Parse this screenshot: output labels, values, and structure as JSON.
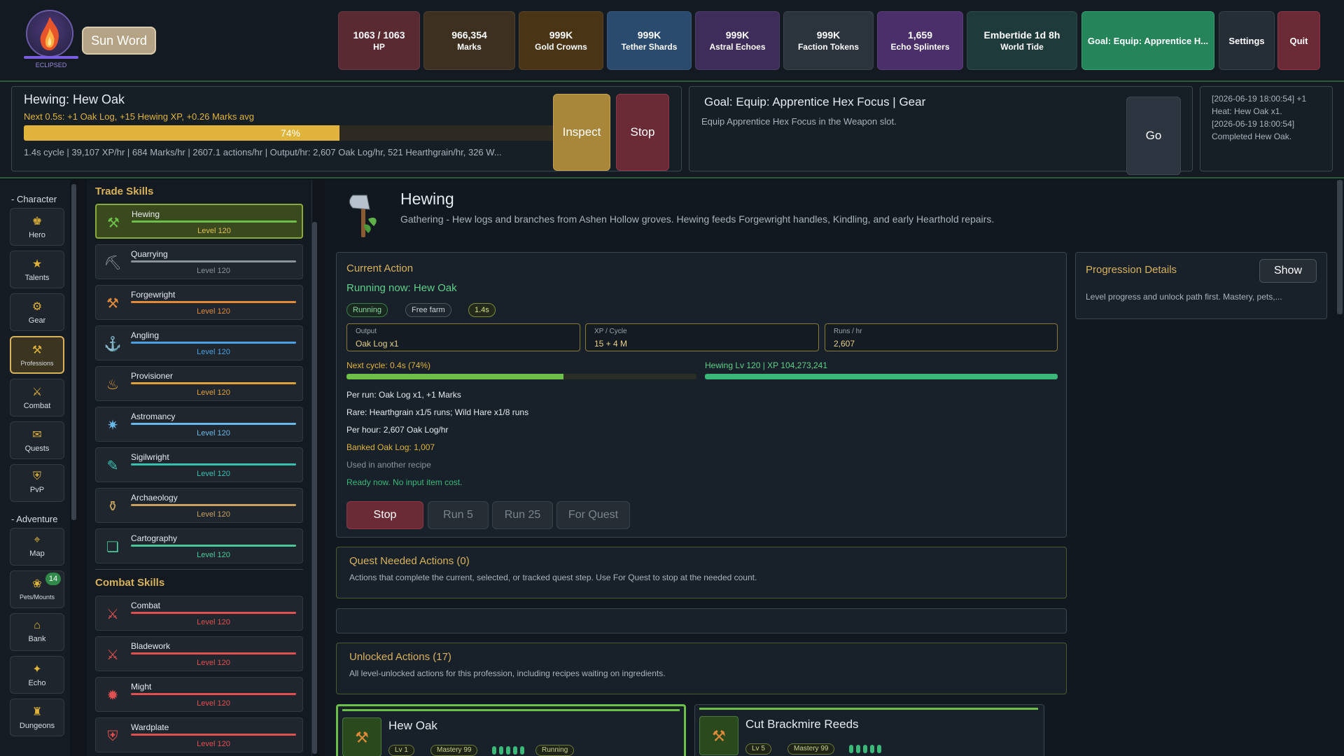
{
  "top": {
    "avatar_label": "ECLIPSED",
    "sun_word": "Sun Word",
    "stats": [
      {
        "value": "1063 / 1063",
        "label": "HP",
        "color": "#5a2a33"
      },
      {
        "value": "966,354",
        "label": "Marks",
        "color": "#3d3020"
      },
      {
        "value": "999K",
        "label": "Gold Crowns",
        "color": "#4a3416"
      },
      {
        "value": "999K",
        "label": "Tether Shards",
        "color": "#2a4a6e"
      },
      {
        "value": "999K",
        "label": "Astral Echoes",
        "color": "#3e2d5a"
      },
      {
        "value": "999K",
        "label": "Faction Tokens",
        "color": "#2b333d"
      },
      {
        "value": "1,659",
        "label": "Echo Splinters",
        "color": "#4a2f6a"
      },
      {
        "value": "Embertide 1d 8h",
        "label": "World Tide",
        "color": "#1f3a3a"
      }
    ],
    "goal_button": "Goal: Equip: Apprentice H...",
    "settings": "Settings",
    "quit": "Quit"
  },
  "action": {
    "title": "Hewing: Hew Oak",
    "next": "Next 0.5s: +1 Oak Log, +15 Hewing XP, +0.26 Marks avg",
    "progress": 74,
    "progress_label": "74%",
    "stats_line": "1.4s cycle | 39,107 XP/hr | 684 Marks/hr | 2607.1 actions/hr | Output/hr: 2,607 Oak Log/hr, 521 Hearthgrain/hr, 326 W...",
    "inspect": "Inspect",
    "stop": "Stop"
  },
  "goal": {
    "title": "Goal: Equip: Apprentice Hex Focus | Gear",
    "desc": "Equip Apprentice Hex Focus in the Weapon slot.",
    "go": "Go"
  },
  "log": [
    "[2026-06-19 18:00:54] +1",
    "Heat: Hew Oak x1.",
    "[2026-06-19 18:00:54]",
    "Completed Hew Oak."
  ],
  "nav": {
    "character_label": "- Character",
    "adventure_label": "- Adventure",
    "character": [
      {
        "icon": "hero-icon",
        "glyph": "♚",
        "label": "Hero"
      },
      {
        "icon": "star-icon",
        "glyph": "★",
        "label": "Talents"
      },
      {
        "icon": "gear-icon",
        "glyph": "⚙",
        "label": "Gear"
      },
      {
        "icon": "anvil-icon",
        "glyph": "⚒",
        "label": "Professions",
        "active": true
      },
      {
        "icon": "swords-icon",
        "glyph": "⚔",
        "label": "Combat"
      },
      {
        "icon": "scroll-icon",
        "glyph": "✉",
        "label": "Quests"
      },
      {
        "icon": "shield-icon",
        "glyph": "⛨",
        "label": "PvP"
      }
    ],
    "adventure": [
      {
        "icon": "map-icon",
        "glyph": "⌖",
        "label": "Map"
      },
      {
        "icon": "paw-icon",
        "glyph": "❀",
        "label": "Pets/Mounts",
        "badge": "14"
      },
      {
        "icon": "bank-icon",
        "glyph": "⌂",
        "label": "Bank"
      },
      {
        "icon": "echo-icon",
        "glyph": "✦",
        "label": "Echo"
      },
      {
        "icon": "dungeon-icon",
        "glyph": "♜",
        "label": "Dungeons"
      }
    ]
  },
  "skills": {
    "trade_title": "Trade Skills",
    "combat_title": "Combat Skills",
    "trade": [
      {
        "name": "Hewing",
        "level": "Level 120",
        "color": "#6cc04a",
        "glyph": "⚒",
        "active": true
      },
      {
        "name": "Quarrying",
        "level": "Level 120",
        "color": "#8a929c",
        "glyph": "⛏"
      },
      {
        "name": "Forgewright",
        "level": "Level 120",
        "color": "#e08a3a",
        "glyph": "⚒"
      },
      {
        "name": "Angling",
        "level": "Level 120",
        "color": "#4aa0e0",
        "glyph": "⚓"
      },
      {
        "name": "Provisioner",
        "level": "Level 120",
        "color": "#e0a03a",
        "glyph": "♨"
      },
      {
        "name": "Astromancy",
        "level": "Level 120",
        "color": "#6ab8e8",
        "glyph": "✷"
      },
      {
        "name": "Sigilwright",
        "level": "Level 120",
        "color": "#3ac0b0",
        "glyph": "✎"
      },
      {
        "name": "Archaeology",
        "level": "Level 120",
        "color": "#c8a060",
        "glyph": "⚱"
      },
      {
        "name": "Cartography",
        "level": "Level 120",
        "color": "#4ac89a",
        "glyph": "❏"
      }
    ],
    "combat": [
      {
        "name": "Combat",
        "level": "Level 120",
        "color": "#e05050",
        "glyph": "⚔"
      },
      {
        "name": "Bladework",
        "level": "Level 120",
        "color": "#e05050",
        "glyph": "⚔"
      },
      {
        "name": "Might",
        "level": "Level 120",
        "color": "#e05050",
        "glyph": "✹"
      },
      {
        "name": "Wardplate",
        "level": "Level 120",
        "color": "#e05050",
        "glyph": "⛨"
      }
    ]
  },
  "profession": {
    "name": "Hewing",
    "desc": "Gathering - Hew logs and branches from Ashen Hollow groves. Hewing feeds Forgewright handles, Kindling, and early Hearthold repairs."
  },
  "current": {
    "heading": "Current Action",
    "running": "Running now: Hew Oak",
    "chips": [
      "Running",
      "Free farm",
      "1.4s"
    ],
    "boxes": [
      {
        "title": "Output",
        "value": "Oak Log x1"
      },
      {
        "title": "XP / Cycle",
        "value": "15 + 4 M"
      },
      {
        "title": "Runs / hr",
        "value": "2,607"
      }
    ],
    "next_cycle": "Next cycle: 0.4s (74%)",
    "next_cycle_pct": 62,
    "level_line": "Hewing Lv 120 | XP 104,273,241",
    "level_pct": 100,
    "per_run": "Per run: Oak Log x1, +1 Marks",
    "rare": "Rare: Hearthgrain x1/5 runs; Wild Hare x1/8 runs",
    "per_hour": "Per hour: 2,607 Oak Log/hr",
    "banked": "Banked Oak Log: 1,007",
    "used": "Used in another recipe",
    "ready": "Ready now. No input item cost.",
    "buttons": {
      "stop": "Stop",
      "run5": "Run 5",
      "run25": "Run 25",
      "quest": "For Quest"
    }
  },
  "progression": {
    "title": "Progression Details",
    "show": "Show",
    "desc": "Level progress and unlock path first. Mastery, pets,..."
  },
  "quest_needed": {
    "title": "Quest Needed Actions (0)",
    "desc": "Actions that complete the current, selected, or tracked quest step. Use For Quest to stop at the needed count."
  },
  "unlocked": {
    "title": "Unlocked Actions (17)",
    "desc": "All level-unlocked actions for this profession, including recipes waiting on ingredients."
  },
  "action_cards": [
    {
      "name": "Hew Oak",
      "tags": [
        "Lv 1",
        "Mastery 99",
        "Running"
      ]
    },
    {
      "name": "Cut Brackmire Reeds",
      "tags": [
        "Lv 5",
        "Mastery 99"
      ]
    }
  ]
}
